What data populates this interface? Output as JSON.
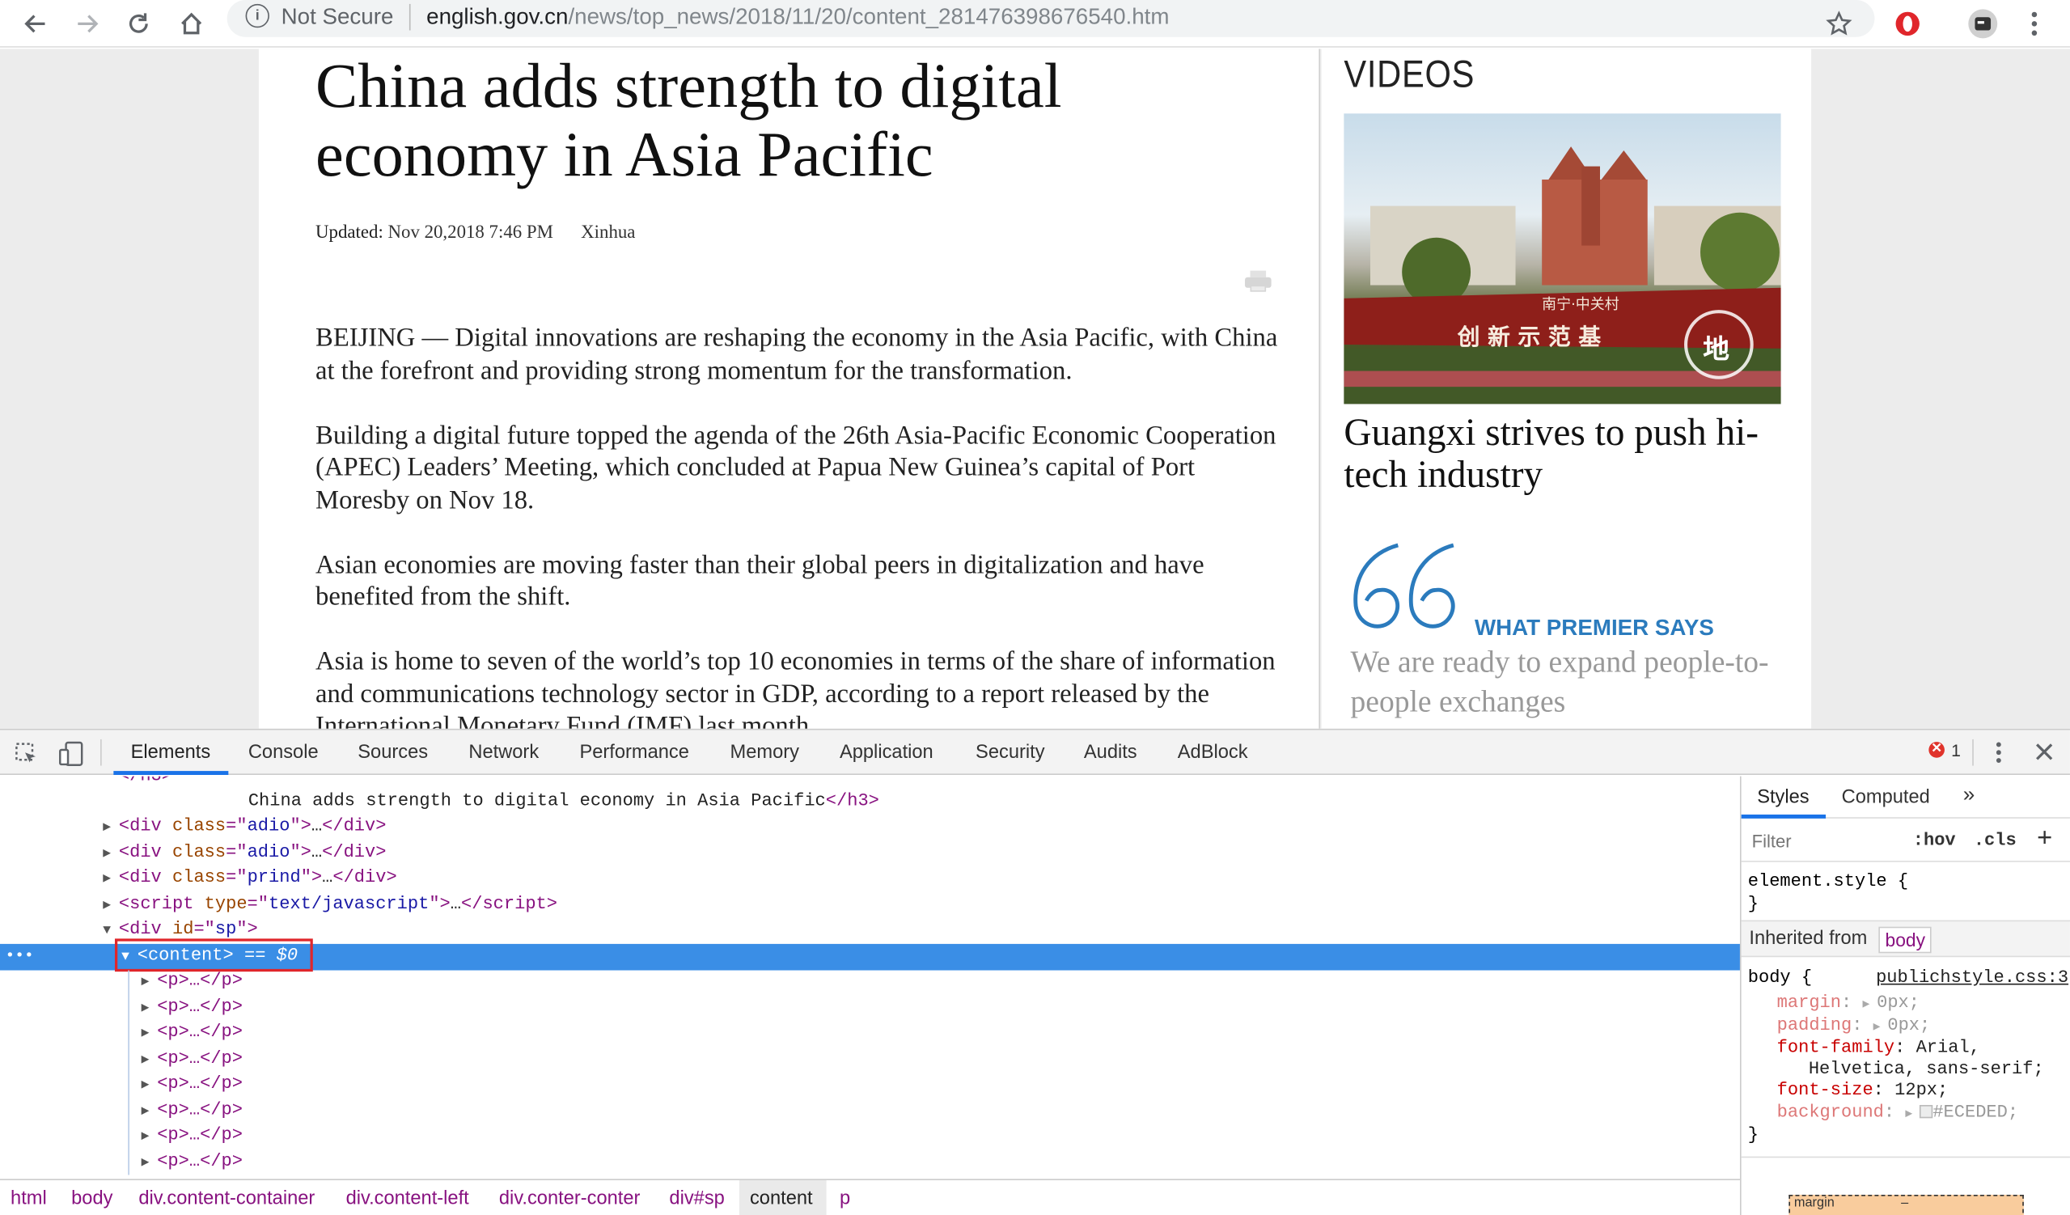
{
  "browser": {
    "security_label": "Not Secure",
    "url_host": "english.gov.cn",
    "url_path": "/news/top_news/2018/11/20/content_281476398676540.htm"
  },
  "article": {
    "title": "China adds strength to digital economy in Asia Pacific",
    "updated_label": "Updated:",
    "updated_value": "Nov 20,2018 7:46 PM",
    "source": "Xinhua",
    "paragraphs": [
      "BEIJING — Digital innovations are reshaping the economy in the Asia Pacific, with China at the forefront and providing strong momentum for the transformation.",
      "Building a digital future topped the agenda of the 26th Asia-Pacific Economic Cooperation (APEC) Leaders’ Meeting, which concluded at Papua New Guinea’s capital of Port Moresby on Nov 18.",
      "Asian economies are moving faster than their global peers in digitalization and have benefited from the shift.",
      "Asia is home to seven of the world’s top 10 economies in terms of the share of information and communications technology sector in GDP, according to a report released by the International Monetary Fund (IMF) last month."
    ]
  },
  "sidebar": {
    "videos_heading": "VIDEOS",
    "video_sign_top": "南宁·中关村",
    "video_sign_main": "创 新 示 范 基",
    "video_sign_last": "地",
    "video_title": "Guangxi strives to push hi-tech industry",
    "premier_label": "WHAT PREMIER SAYS",
    "quote": "We are ready to expand people-to-people exchanges"
  },
  "devtools": {
    "tabs": [
      "Elements",
      "Console",
      "Sources",
      "Network",
      "Performance",
      "Memory",
      "Application",
      "Security",
      "Audits",
      "AdBlock"
    ],
    "error_count": "1",
    "dom": {
      "h3_close_frag": "</h3>",
      "h3_text": "China adds strength to digital economy in Asia Pacific",
      "div_adio_1": "adio",
      "div_adio_2": "adio",
      "div_prind": "prind",
      "script_type": "text/javascript",
      "div_sp": "sp",
      "selected_tag": "<content>",
      "selected_eq": "== $0",
      "p_line": "<p>…</p>",
      "ellipsis": "…"
    },
    "breadcrumbs": [
      "html",
      "body",
      "div.content-container",
      "div.content-left",
      "div.conter-conter",
      "div#sp",
      "content",
      "p"
    ],
    "styles": {
      "tabs": [
        "Styles",
        "Computed"
      ],
      "filter_placeholder": "Filter",
      "hov": ":hov",
      "cls": ".cls",
      "element_style": "element.style {",
      "close_brace": "}",
      "inherited_from": "Inherited from",
      "inherited_tag": "body",
      "body_selector": "body {",
      "stylesheet_link": "publichstyle.css:3",
      "rules": [
        {
          "prop": "margin",
          "value": "0px;",
          "disabled": true
        },
        {
          "prop": "padding",
          "value": "0px;",
          "disabled": true
        },
        {
          "prop": "font-family",
          "value": "Arial,",
          "disabled": false
        },
        {
          "prop": "",
          "value": "Helvetica, sans-serif;",
          "disabled": false
        },
        {
          "prop": "font-size",
          "value": "12px;",
          "disabled": false
        },
        {
          "prop": "background",
          "value": "#ECEDED;",
          "disabled": true
        }
      ],
      "box_model_label": "margin",
      "box_model_value": "–"
    }
  }
}
